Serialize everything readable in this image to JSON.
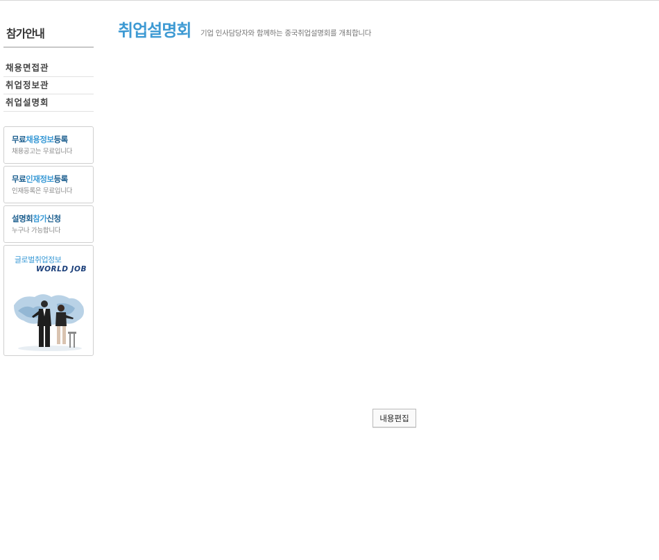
{
  "sidebar": {
    "title": "참가안내",
    "menu": [
      {
        "label": "채용면접관"
      },
      {
        "label": "취업정보관"
      },
      {
        "label": "취업설명회"
      }
    ],
    "boxes": [
      {
        "title_dark_1": "무료",
        "title_light": "채용정보",
        "title_dark_2": "등록",
        "subtitle": "채용공고는 무료입니다"
      },
      {
        "title_dark_1": "무료",
        "title_light": "인재정보",
        "title_dark_2": "등록",
        "subtitle": "인재등록은 무료입니다"
      },
      {
        "title_dark_1": "설명회",
        "title_light": "참가",
        "title_dark_2": "신청",
        "subtitle": "누구나 가능합니다"
      }
    ],
    "banner": {
      "title": "글로벌취업정보",
      "logo": "WORLD JOB"
    }
  },
  "main": {
    "title": "취업설명회",
    "subtitle": "기업 인사담당자와 함께하는 중국취업설명회를 개최합니다",
    "edit_button": "내용편집"
  },
  "colors": {
    "accent": "#3e9ad3",
    "dark_blue": "#1d5f8f",
    "border": "#cfcfcf"
  }
}
